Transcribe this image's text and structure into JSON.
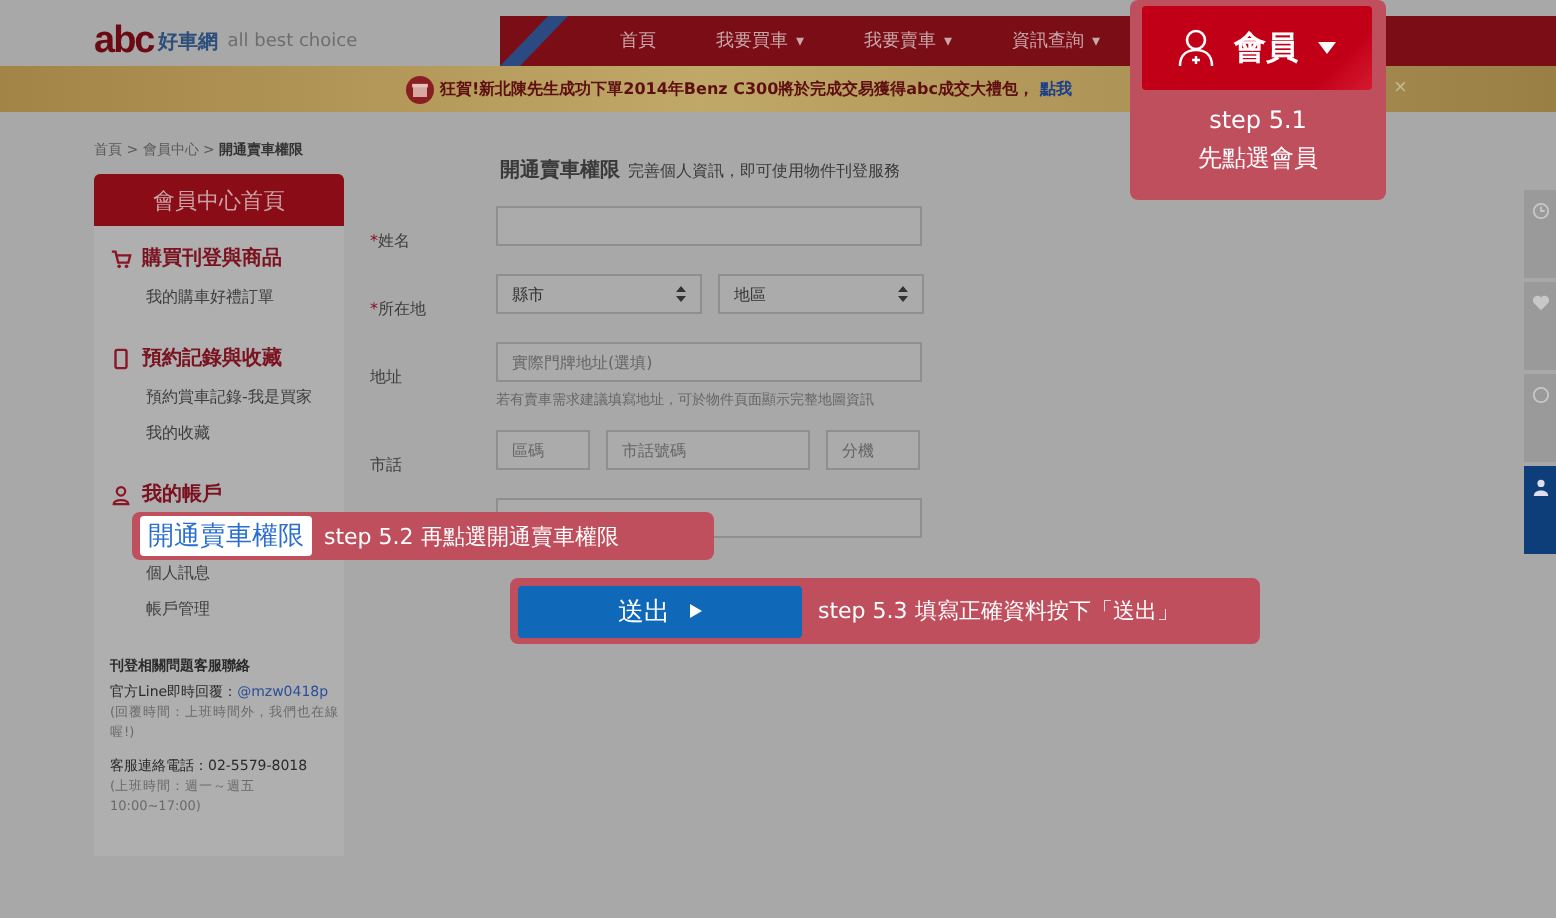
{
  "header": {
    "logo": {
      "mark": "abc",
      "brand": "好車網",
      "tagline": "all best choice"
    },
    "nav": [
      {
        "label": "首頁"
      },
      {
        "label": "我要買車",
        "caret": "▾"
      },
      {
        "label": "我要賣車",
        "caret": "▾"
      },
      {
        "label": "資訊查詢",
        "caret": "▾"
      }
    ]
  },
  "banner": {
    "text": "狂賀!新北陳先生成功下單2014年Benz C300將於完成交易獲得abc成交大禮包，",
    "link": "點我",
    "close": "×"
  },
  "breadcrumb": "首頁 > 會員中心 > **開通賣車權限**",
  "sidebar": {
    "header": "會員中心首頁",
    "sections": [
      {
        "title": "購買刊登與商品",
        "items": [
          "我的購車好禮訂單"
        ]
      },
      {
        "title": "預約記錄與收藏",
        "items": [
          "預約賞車記錄-我是買家",
          "我的收藏"
        ]
      },
      {
        "title": "我的帳戶",
        "items": [
          "個人訊息",
          "帳戶管理"
        ]
      }
    ],
    "contact": {
      "title": "刊登相關問題客服聯絡",
      "line_label": "官方Line即時回覆：",
      "line_id": "@mzw0418p",
      "line_hint": "(回覆時間：上班時間外，我們也在線喔!)",
      "phone": "客服連絡電話：02-5579-8018",
      "hours": "(上班時間：週一～週五10:00~17:00)"
    }
  },
  "form": {
    "title": "開通賣車權限",
    "subtitle": "完善個人資訊，即可使用物件刊登服務",
    "rows": [
      {
        "label": "姓名",
        "required_mark": "*",
        "fields": [
          {
            "kind": "input"
          }
        ]
      },
      {
        "label": "所在地",
        "required_mark": "*",
        "fields": [
          {
            "kind": "select",
            "value": "縣市"
          },
          {
            "kind": "select",
            "value": "地區"
          }
        ]
      },
      {
        "label": "地址",
        "fields": [
          {
            "kind": "input",
            "placeholder": "實際門牌地址(選填)"
          }
        ],
        "hint": "若有賣車需求建議填寫地址，可於物件頁面顯示完整地圖資訊"
      },
      {
        "label": "市話",
        "fields": [
          {
            "kind": "input",
            "placeholder": "區碼"
          },
          {
            "kind": "input",
            "placeholder": "市話號碼"
          },
          {
            "kind": "input",
            "placeholder": "分機"
          }
        ]
      },
      {
        "fields": [
          {
            "kind": "input"
          }
        ]
      }
    ]
  },
  "side_tabs": [
    {
      "selected": false
    },
    {
      "selected": false
    },
    {
      "selected": false
    },
    {
      "selected": true
    }
  ],
  "callouts": [
    {
      "kind": "member",
      "button": "會員",
      "step": "step 5.1",
      "text": "先點選會員"
    },
    {
      "kind": "menu",
      "highlight": "開通賣車權限",
      "text": "step 5.2 再點選開通賣車權限"
    },
    {
      "kind": "submit",
      "button": "送出",
      "text": "step 5.3 填寫正確資料按下「送出」"
    }
  ]
}
